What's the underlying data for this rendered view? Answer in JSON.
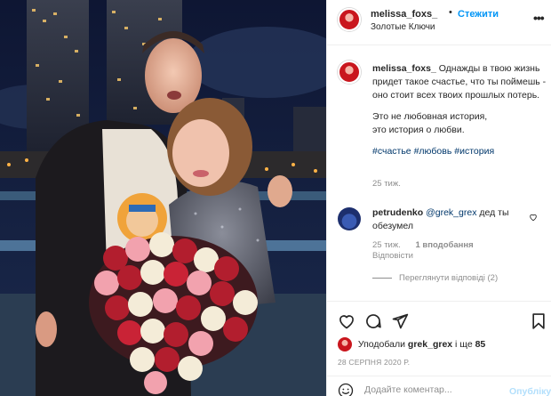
{
  "post": {
    "username": "melissa_foxs_",
    "dot": "•",
    "follow_label": "Стежити",
    "location": "Золотые Ключи",
    "more_icon": "more-dots-icon"
  },
  "caption": {
    "username": "melissa_foxs_",
    "text1": "Однажды в твою жизнь придет такое счастье, что ты поймешь - оно стоит всех твоих прошлых потерь.",
    "text2": "Это не любовная история,",
    "text3": "это история о любви.",
    "hashtags": [
      "#счастье",
      "#любовь",
      "#история"
    ],
    "time": "25 тиж."
  },
  "comment": {
    "username": "petrudenko",
    "mention": "@grek_grex",
    "text": "дед ты обезумел",
    "time": "25 тиж.",
    "likes": "1 вподобання",
    "reply": "Відповісти",
    "view_replies": "Переглянути відповіді (2)"
  },
  "likes": {
    "prefix": "Уподобали",
    "user": "grek_grex",
    "middle": "і ще",
    "count": "85"
  },
  "date": "28 СЕРПНЯ 2020 Р.",
  "add_comment": {
    "placeholder": "Додайте коментар...",
    "publish": "Опублікувати"
  },
  "colors": {
    "accent": "#0095f6",
    "publish_disabled": "#b2dffc",
    "secondary_text": "#8e8e8e"
  }
}
